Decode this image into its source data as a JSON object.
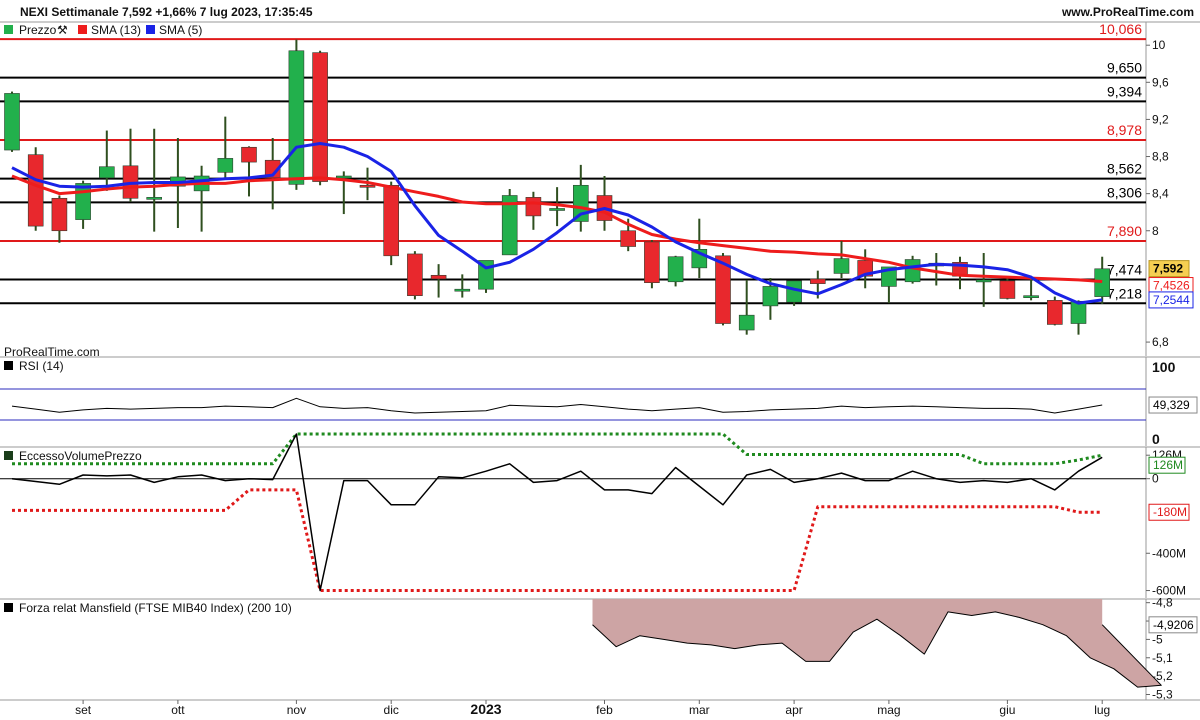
{
  "header": {
    "title": "NEXI Settimanale 7,592 +1,66% 7 lug 2023, 17:35:45",
    "site": "www.ProRealTime.com"
  },
  "watermark": "ProRealTime.com",
  "colors": {
    "up": "#22b04c",
    "down": "#e8282d",
    "sma13": "#ee1c1c",
    "sma5": "#1a23e6",
    "hline_red": "#e0191a",
    "hline_black": "#000000",
    "rsi_bands": "#2b2bbd",
    "positive": "#1f8a1f",
    "negative": "#e0191a",
    "mansfield_fill": "#cda4a4",
    "price_tag_bg": "#f5cf52"
  },
  "legend": {
    "price": "Prezzo",
    "sma13": "SMA (13)",
    "sma5": "SMA (5)"
  },
  "x_labels": [
    {
      "label": "set",
      "bar": 3
    },
    {
      "label": "ott",
      "bar": 7
    },
    {
      "label": "nov",
      "bar": 12
    },
    {
      "label": "dic",
      "bar": 16
    },
    {
      "label": "2023",
      "bar": 20,
      "bold": true
    },
    {
      "label": "feb",
      "bar": 25
    },
    {
      "label": "mar",
      "bar": 29
    },
    {
      "label": "apr",
      "bar": 33
    },
    {
      "label": "mag",
      "bar": 37
    },
    {
      "label": "giu",
      "bar": 42
    },
    {
      "label": "lug",
      "bar": 46
    }
  ],
  "chart_data": [
    {
      "type": "candlestick",
      "title": "NEXI Settimanale",
      "ylim": [
        6.65,
        10.25
      ],
      "y_ticks": [
        "10",
        "9,6",
        "9,2",
        "8,8",
        "8,4",
        "8",
        "6,8"
      ],
      "y_tick_values": [
        10,
        9.6,
        9.2,
        8.8,
        8.4,
        8.0,
        6.8
      ],
      "horizontal_levels": [
        {
          "value": 10.066,
          "label": "10,066",
          "color": "red"
        },
        {
          "value": 9.65,
          "label": "9,650",
          "color": "black"
        },
        {
          "value": 9.394,
          "label": "9,394",
          "color": "black"
        },
        {
          "value": 8.978,
          "label": "8,978",
          "color": "red"
        },
        {
          "value": 8.562,
          "label": "8,562",
          "color": "black"
        },
        {
          "value": 8.306,
          "label": "8,306",
          "color": "black"
        },
        {
          "value": 7.89,
          "label": "7,890",
          "color": "red"
        },
        {
          "value": 7.474,
          "label": "7,474",
          "color": "black"
        },
        {
          "value": 7.218,
          "label": "7,218",
          "color": "black"
        }
      ],
      "last_price": {
        "value": 7.592,
        "label": "7,592"
      },
      "sma13_last": {
        "value": 7.4526,
        "label": "7,4526"
      },
      "sma5_last": {
        "value": 7.2544,
        "label": "7,2544"
      },
      "candles": [
        {
          "o": 8.87,
          "h": 9.5,
          "l": 8.85,
          "c": 9.48
        },
        {
          "o": 8.82,
          "h": 8.9,
          "l": 8.0,
          "c": 8.05
        },
        {
          "o": 8.35,
          "h": 8.38,
          "l": 7.87,
          "c": 8.0
        },
        {
          "o": 8.12,
          "h": 8.54,
          "l": 8.02,
          "c": 8.51
        },
        {
          "o": 8.57,
          "h": 9.08,
          "l": 8.43,
          "c": 8.69
        },
        {
          "o": 8.7,
          "h": 9.1,
          "l": 8.31,
          "c": 8.35
        },
        {
          "o": 8.35,
          "h": 9.1,
          "l": 7.99,
          "c": 8.36
        },
        {
          "o": 8.48,
          "h": 9.0,
          "l": 8.03,
          "c": 8.58
        },
        {
          "o": 8.43,
          "h": 8.7,
          "l": 7.99,
          "c": 8.59
        },
        {
          "o": 8.63,
          "h": 9.23,
          "l": 8.55,
          "c": 8.78
        },
        {
          "o": 8.9,
          "h": 8.91,
          "l": 8.37,
          "c": 8.74
        },
        {
          "o": 8.76,
          "h": 9.0,
          "l": 8.23,
          "c": 8.57
        },
        {
          "o": 8.5,
          "h": 10.06,
          "l": 8.44,
          "c": 9.94
        },
        {
          "o": 9.92,
          "h": 9.94,
          "l": 8.49,
          "c": 8.53
        },
        {
          "o": 8.59,
          "h": 8.64,
          "l": 8.18,
          "c": 8.59
        },
        {
          "o": 8.49,
          "h": 8.68,
          "l": 8.33,
          "c": 8.48
        },
        {
          "o": 8.49,
          "h": 8.53,
          "l": 7.63,
          "c": 7.73
        },
        {
          "o": 7.75,
          "h": 7.78,
          "l": 7.26,
          "c": 7.3
        },
        {
          "o": 7.52,
          "h": 7.64,
          "l": 7.28,
          "c": 7.48
        },
        {
          "o": 7.37,
          "h": 7.53,
          "l": 7.28,
          "c": 7.37
        },
        {
          "o": 7.37,
          "h": 7.57,
          "l": 7.33,
          "c": 7.68
        },
        {
          "o": 7.74,
          "h": 8.45,
          "l": 7.74,
          "c": 8.38
        },
        {
          "o": 8.36,
          "h": 8.42,
          "l": 8.01,
          "c": 8.16
        },
        {
          "o": 8.24,
          "h": 8.47,
          "l": 8.05,
          "c": 8.24
        },
        {
          "o": 8.1,
          "h": 8.71,
          "l": 7.99,
          "c": 8.49
        },
        {
          "o": 8.38,
          "h": 8.59,
          "l": 8.0,
          "c": 8.11
        },
        {
          "o": 8.0,
          "h": 8.13,
          "l": 7.78,
          "c": 7.83
        },
        {
          "o": 7.88,
          "h": 7.9,
          "l": 7.38,
          "c": 7.44
        },
        {
          "o": 7.45,
          "h": 7.73,
          "l": 7.4,
          "c": 7.72
        },
        {
          "o": 7.6,
          "h": 8.13,
          "l": 7.49,
          "c": 7.8
        },
        {
          "o": 7.73,
          "h": 7.76,
          "l": 6.98,
          "c": 7.0
        },
        {
          "o": 6.93,
          "h": 7.47,
          "l": 6.88,
          "c": 7.09
        },
        {
          "o": 7.19,
          "h": 7.49,
          "l": 7.04,
          "c": 7.4
        },
        {
          "o": 7.23,
          "h": 7.45,
          "l": 7.19,
          "c": 7.46
        },
        {
          "o": 7.48,
          "h": 7.57,
          "l": 7.27,
          "c": 7.43
        },
        {
          "o": 7.54,
          "h": 7.89,
          "l": 7.49,
          "c": 7.7
        },
        {
          "o": 7.68,
          "h": 7.8,
          "l": 7.38,
          "c": 7.51
        },
        {
          "o": 7.4,
          "h": 7.59,
          "l": 7.22,
          "c": 7.61
        },
        {
          "o": 7.45,
          "h": 7.73,
          "l": 7.43,
          "c": 7.69
        },
        {
          "o": 7.65,
          "h": 7.76,
          "l": 7.41,
          "c": 7.62
        },
        {
          "o": 7.66,
          "h": 7.72,
          "l": 7.37,
          "c": 7.51
        },
        {
          "o": 7.46,
          "h": 7.76,
          "l": 7.18,
          "c": 7.47
        },
        {
          "o": 7.46,
          "h": 7.51,
          "l": 7.26,
          "c": 7.27
        },
        {
          "o": 7.3,
          "h": 7.48,
          "l": 7.25,
          "c": 7.3
        },
        {
          "o": 7.25,
          "h": 7.29,
          "l": 6.98,
          "c": 6.99
        },
        {
          "o": 7.0,
          "h": 7.25,
          "l": 6.88,
          "c": 7.24
        },
        {
          "o": 7.29,
          "h": 7.72,
          "l": 7.21,
          "c": 7.59
        }
      ],
      "series": [
        {
          "name": "SMA (13)",
          "values": [
            8.59,
            8.49,
            8.4,
            8.42,
            8.45,
            8.47,
            8.48,
            8.5,
            8.51,
            8.51,
            8.54,
            8.55,
            8.56,
            8.57,
            8.55,
            8.52,
            8.47,
            8.42,
            8.37,
            8.31,
            8.29,
            8.29,
            8.3,
            8.28,
            8.25,
            8.2,
            8.07,
            7.96,
            7.91,
            7.87,
            7.84,
            7.81,
            7.78,
            7.77,
            7.75,
            7.74,
            7.7,
            7.66,
            7.6,
            7.56,
            7.52,
            7.51,
            7.5,
            7.49,
            7.48,
            7.47,
            7.4526
          ]
        },
        {
          "name": "SMA (5)",
          "values": [
            8.68,
            8.55,
            8.48,
            8.47,
            8.48,
            8.51,
            8.52,
            8.52,
            8.54,
            8.56,
            8.57,
            8.6,
            8.9,
            8.94,
            8.9,
            8.8,
            8.64,
            8.27,
            7.95,
            7.78,
            7.6,
            7.66,
            7.8,
            7.98,
            8.18,
            8.24,
            8.17,
            8.04,
            7.88,
            7.76,
            7.65,
            7.53,
            7.43,
            7.37,
            7.32,
            7.42,
            7.53,
            7.58,
            7.61,
            7.64,
            7.63,
            7.61,
            7.58,
            7.5,
            7.33,
            7.22,
            7.2544
          ]
        }
      ]
    },
    {
      "type": "line",
      "title": "RSI (14)",
      "ylim": [
        0,
        100
      ],
      "y_ticks": [
        "100",
        "0"
      ],
      "bands": [
        70,
        30
      ],
      "last_value": {
        "value": 49.329,
        "label": "49,329"
      },
      "series": [
        {
          "name": "RSI (14)",
          "values": [
            48,
            44,
            40,
            43,
            45,
            44,
            45,
            46,
            46,
            48,
            47,
            46,
            58,
            47,
            45,
            46,
            42,
            39,
            40,
            41,
            42,
            49,
            48,
            47,
            50,
            47,
            44,
            42,
            44,
            46,
            40,
            41,
            43,
            44,
            45,
            48,
            46,
            47,
            48,
            47,
            46,
            45,
            45,
            44,
            39,
            44,
            49.329
          ]
        }
      ]
    },
    {
      "type": "line",
      "title": "EccessoVolumePrezzo",
      "ylim": [
        -640,
        170
      ],
      "y_ticks": [
        "126M",
        "0",
        "-400M",
        "-600M"
      ],
      "y_tick_values": [
        126,
        0,
        -400,
        -600
      ],
      "last_upper": {
        "value": 126,
        "label": "126M"
      },
      "last_lower": {
        "value": -180,
        "label": "-180M"
      },
      "series": [
        {
          "name": "EccessoVolumePrezzo",
          "values": [
            0,
            -15,
            -30,
            20,
            15,
            20,
            -20,
            10,
            20,
            -10,
            0,
            -5,
            240,
            -600,
            -10,
            -10,
            -140,
            -140,
            10,
            5,
            40,
            80,
            -20,
            -10,
            40,
            -60,
            -60,
            -80,
            60,
            -40,
            -140,
            20,
            50,
            -20,
            0,
            30,
            -10,
            -10,
            40,
            0,
            -20,
            -10,
            -20,
            0,
            -60,
            40,
            115
          ]
        },
        {
          "name": "upper",
          "values": [
            80,
            80,
            80,
            80,
            80,
            80,
            80,
            80,
            80,
            80,
            80,
            80,
            240,
            240,
            240,
            240,
            240,
            240,
            240,
            240,
            240,
            240,
            240,
            240,
            240,
            240,
            240,
            240,
            240,
            240,
            240,
            130,
            130,
            130,
            130,
            130,
            130,
            130,
            130,
            130,
            130,
            80,
            80,
            80,
            80,
            100,
            126
          ]
        },
        {
          "name": "lower",
          "values": [
            -170,
            -170,
            -170,
            -170,
            -170,
            -170,
            -170,
            -170,
            -170,
            -170,
            -60,
            -60,
            -60,
            -600,
            -600,
            -600,
            -600,
            -600,
            -600,
            -600,
            -600,
            -600,
            -600,
            -600,
            -600,
            -600,
            -600,
            -600,
            -600,
            -600,
            -600,
            -600,
            -600,
            -600,
            -150,
            -150,
            -150,
            -150,
            -150,
            -150,
            -150,
            -150,
            -150,
            -150,
            -150,
            -180,
            -180
          ]
        }
      ]
    },
    {
      "type": "area",
      "title": "Forza relat Mansfield (FTSE MIB40 Index) (200 10)",
      "ylim": [
        -5.33,
        -4.78
      ],
      "y_ticks": [
        "-4,8",
        "-4,9",
        "-5",
        "-5,1",
        "-5,2",
        "-5,3"
      ],
      "y_tick_values": [
        -4.8,
        -4.9,
        -5.0,
        -5.1,
        -5.2,
        -5.3
      ],
      "baseline": -4.78,
      "start_bar": 25,
      "last_value": {
        "value": -4.9206,
        "label": "-4,9206"
      },
      "series": [
        {
          "name": "Mansfield",
          "values": [
            -4.92,
            -5.04,
            -4.98,
            -5.0,
            -5.02,
            -5.03,
            -5.05,
            -5.03,
            -5.02,
            -5.12,
            -5.12,
            -4.96,
            -4.89,
            -4.98,
            -5.08,
            -4.85,
            -4.87,
            -4.85,
            -4.88,
            -4.92,
            -4.98,
            -5.1,
            -5.16,
            -5.26,
            -5.25,
            -4.92
          ]
        }
      ]
    }
  ]
}
